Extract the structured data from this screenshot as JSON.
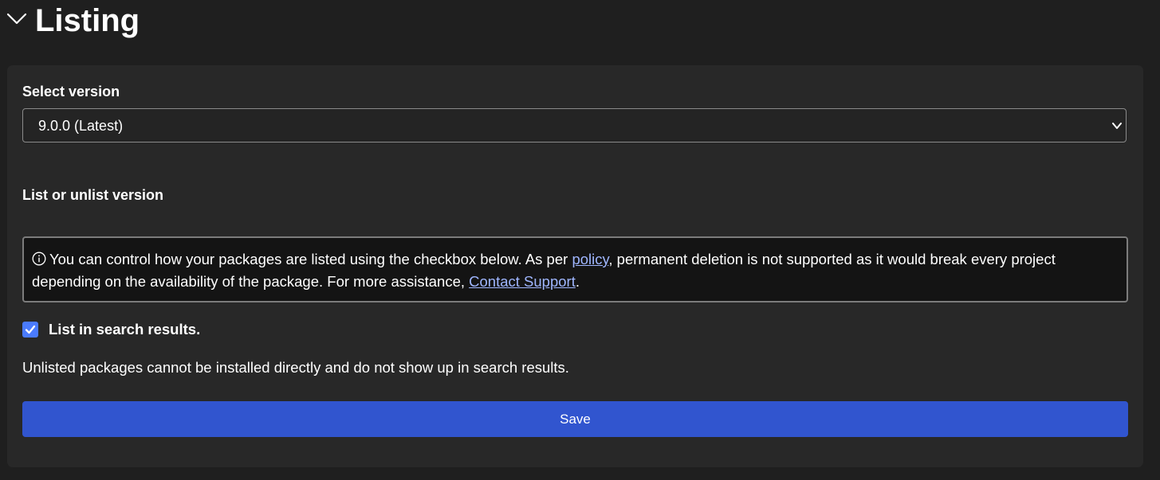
{
  "section": {
    "title": "Listing",
    "collapse_icon": "chevron-down-icon"
  },
  "version": {
    "label": "Select version",
    "selected": "9.0.0 (Latest)",
    "dropdown_icon": "chevron-down-icon"
  },
  "listing": {
    "heading": "List or unlist version",
    "notice": {
      "icon": "info-icon",
      "text_before_policy": "You can control how your packages are listed using the checkbox below. As per ",
      "policy_link": "policy",
      "text_after_policy": ", permanent deletion is not supported as it would break every project depending on the availability of the package. For more assistance, ",
      "support_link": "Contact Support",
      "text_end": "."
    },
    "checkbox_label": "List in search results.",
    "checkbox_checked": true,
    "help_text": "Unlisted packages cannot be installed directly and do not show up in search results.",
    "save_label": "Save"
  },
  "colors": {
    "page_background": "#1f1f1f",
    "panel_background": "#282828",
    "notice_background": "#141414",
    "link": "#9fb6ff",
    "checkbox_accent": "#4a7bff",
    "primary_button": "#3155cf"
  }
}
